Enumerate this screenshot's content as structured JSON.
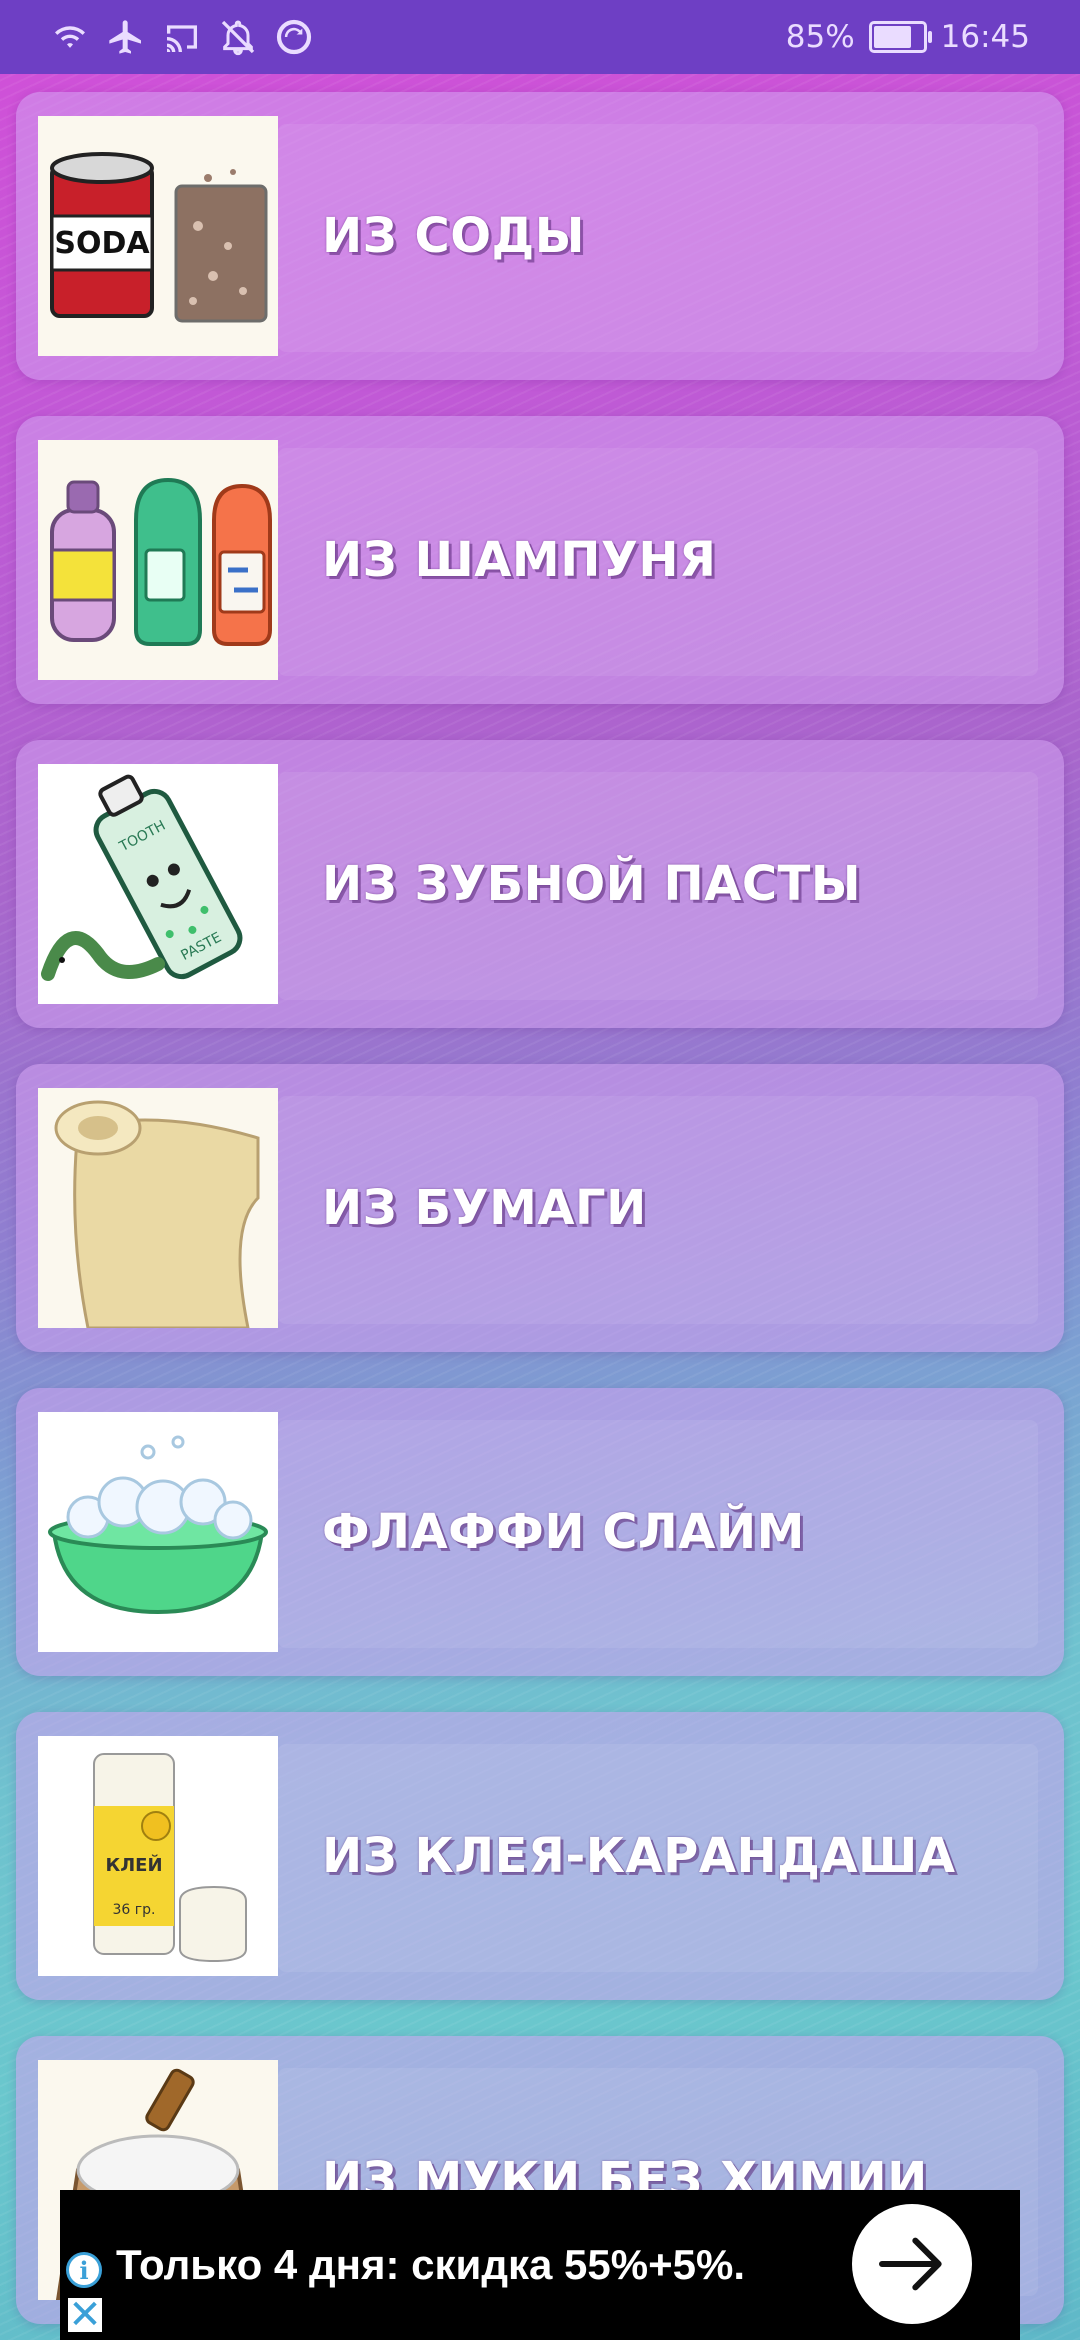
{
  "status_bar": {
    "battery_text": "85%",
    "battery_level": 0.85,
    "time": "16:45",
    "icons": [
      "wifi-icon",
      "airplane-icon",
      "cast-icon",
      "notifications-off-icon",
      "sync-icon"
    ]
  },
  "items": [
    {
      "label": "ИЗ СОДЫ",
      "icon": "soda-can-icon"
    },
    {
      "label": "ИЗ ШАМПУНЯ",
      "icon": "shampoo-bottles-icon"
    },
    {
      "label": "ИЗ ЗУБНОЙ ПАСТЫ",
      "icon": "toothpaste-icon"
    },
    {
      "label": "ИЗ БУМАГИ",
      "icon": "paper-scroll-icon"
    },
    {
      "label": "ФЛАФФИ СЛАЙМ",
      "icon": "foam-basin-icon"
    },
    {
      "label": "ИЗ КЛЕЯ-КАРАНДАША",
      "icon": "glue-stick-icon"
    },
    {
      "label": "ИЗ МУКИ БЕЗ ХИМИИ",
      "icon": "flour-sack-icon"
    }
  ],
  "ad": {
    "text": "Только 4 дня: скидка 55%+5%.",
    "info_icon": "i",
    "close_icon": "✕"
  }
}
